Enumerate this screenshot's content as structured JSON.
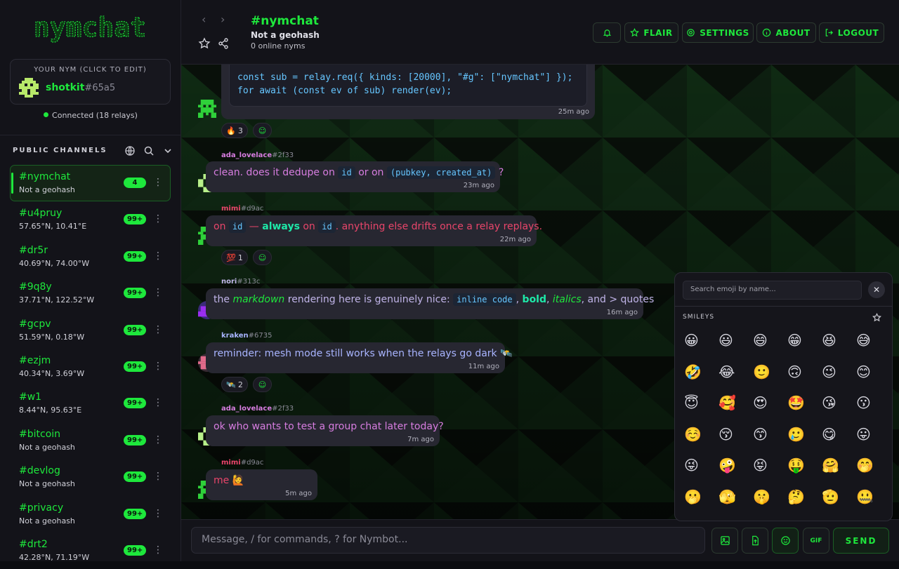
{
  "app": {
    "logo_text": "nymchat"
  },
  "nym_card": {
    "caption": "YOUR NYM (CLICK TO EDIT)",
    "name": "shotkit",
    "tag": "#65a5"
  },
  "connection": {
    "status": "Connected (18 relays)"
  },
  "sidebar": {
    "section_title": "PUBLIC CHANNELS",
    "channels": [
      {
        "name": "#nymchat",
        "sub": "Not a geohash",
        "badge": "4"
      },
      {
        "name": "#u4pruy",
        "sub": "57.65°N, 10.41°E",
        "badge": "99+"
      },
      {
        "name": "#dr5r",
        "sub": "40.69°N, 74.00°W",
        "badge": "99+"
      },
      {
        "name": "#9q8y",
        "sub": "37.71°N, 122.52°W",
        "badge": "99+"
      },
      {
        "name": "#gcpv",
        "sub": "51.59°N, 0.18°W",
        "badge": "99+"
      },
      {
        "name": "#ezjm",
        "sub": "40.34°N, 3.69°W",
        "badge": "99+"
      },
      {
        "name": "#w1",
        "sub": "8.44°N, 95.63°E",
        "badge": "99+"
      },
      {
        "name": "#bitcoin",
        "sub": "Not a geohash",
        "badge": "99+"
      },
      {
        "name": "#devlog",
        "sub": "Not a geohash",
        "badge": "99+"
      },
      {
        "name": "#privacy",
        "sub": "Not a geohash",
        "badge": "99+"
      },
      {
        "name": "#drt2",
        "sub": "42.28°N, 71.19°W",
        "badge": "99+"
      }
    ],
    "menu_glyph": "⋮"
  },
  "header": {
    "nav_back": "‹",
    "nav_forward": "›",
    "title": "#nymchat",
    "subtitle": "Not a geohash",
    "online": "0 online nyms",
    "buttons": {
      "flair": "FLAIR",
      "settings": "SETTINGS",
      "about": "ABOUT",
      "logout": "LOGOUT"
    }
  },
  "messages": {
    "m0": {
      "code_line1": "const sub = relay.req({ kinds: [20000], \"#g\": [\"nymchat\"] });",
      "code_line2": "for await (const ev of sub) render(ev);",
      "time": "25m ago",
      "reaction_emoji": "🔥",
      "reaction_count": "3"
    },
    "m1": {
      "user": "ada_lovelace",
      "tag": "#2f33",
      "t1": "clean. does it dedupe on ",
      "c1": "id",
      "t2": " or on ",
      "c2": "(pubkey, created_at)",
      "t3": " ?",
      "time": "23m ago"
    },
    "m2": {
      "user": "mimi",
      "tag": "#d9ac",
      "t1": "on ",
      "c1": "id",
      "t2": " — ",
      "bold": "always",
      "t3": " on ",
      "c2": "id",
      "t4": ". anything else drifts once a relay replays.",
      "time": "22m ago",
      "reaction_emoji": "💯",
      "reaction_count": "1"
    },
    "m3": {
      "user": "nori",
      "tag": "#313c",
      "t1": "the ",
      "ital1": "markdown",
      "t2": " rendering here is genuinely nice: ",
      "c1": "inline code",
      "t3": ", ",
      "bold": "bold",
      "t4": ", ",
      "ital2": "italics",
      "t5": ", and > quotes",
      "time": "16m ago"
    },
    "m4": {
      "user": "kraken",
      "tag": "#6735",
      "text": "reminder: mesh mode still works when the relays go dark 🛰️",
      "time": "11m ago",
      "reaction_emoji": "🛰️",
      "reaction_count": "2"
    },
    "m5": {
      "user": "ada_lovelace",
      "tag": "#2f33",
      "text": "ok who wants to test a group chat later today?",
      "time": "7m ago"
    },
    "m6": {
      "user": "mimi",
      "tag": "#d9ac",
      "text": "me 🙋",
      "time": "5m ago"
    }
  },
  "composer": {
    "placeholder": "Message, / for commands, ? for Nymbot...",
    "gif_label": "GIF",
    "send_label": "SEND"
  },
  "emoji_picker": {
    "search_placeholder": "Search emoji by name...",
    "close": "✕",
    "category": "SMILEYS",
    "emojis": [
      "😀",
      "😃",
      "😄",
      "😁",
      "😆",
      "😅",
      "🤣",
      "😂",
      "🙂",
      "🙃",
      "😉",
      "😊",
      "😇",
      "🥰",
      "😍",
      "🤩",
      "😘",
      "😗",
      "☺️",
      "😚",
      "😙",
      "🥲",
      "😋",
      "😛",
      "😜",
      "🤪",
      "😝",
      "🤑",
      "🤗",
      "🤭",
      "🫢",
      "🫣",
      "🤫",
      "🤔",
      "🫡",
      "🤐"
    ]
  },
  "colors": {
    "accent": "#1ee83c",
    "ada": "#d77de0",
    "mimi": "#e8456a",
    "nori": "#c0b4e8",
    "kraken": "#a8b4ff"
  }
}
